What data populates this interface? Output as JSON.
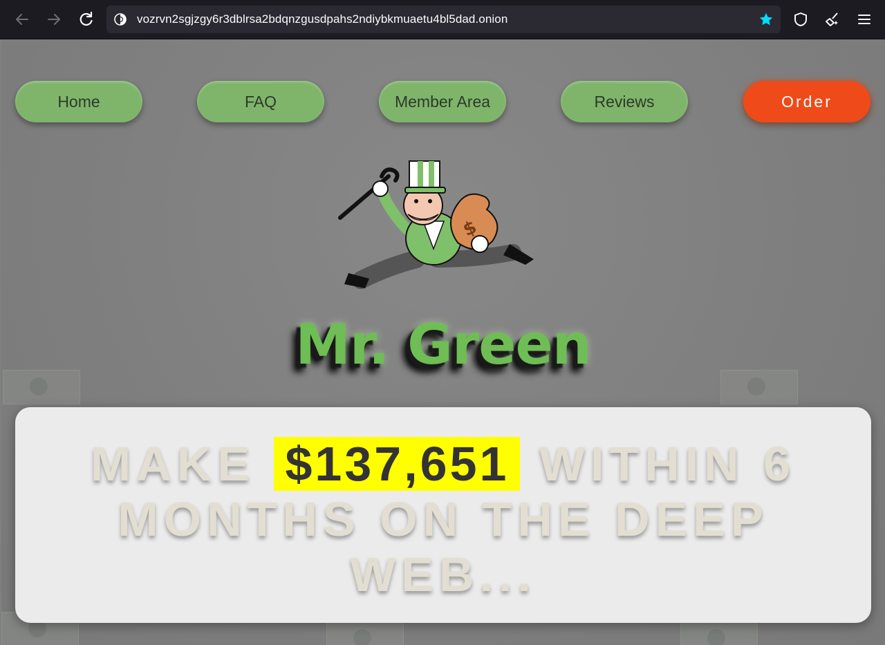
{
  "browser": {
    "url": "vozrvn2sgjzgy6r3dblrsa2bdqnzgusdpahs2ndiybkmuaetu4bl5dad.onion",
    "icons": [
      "back-arrow-icon",
      "forward-arrow-icon",
      "reload-icon",
      "tor-onion-icon",
      "bookmark-star-icon",
      "shield-icon",
      "new-identity-broom-icon",
      "menu-hamburger-icon"
    ],
    "star_color": "#00ddff"
  },
  "nav": {
    "home": "Home",
    "faq": "FAQ",
    "member_area": "Member Area",
    "reviews": "Reviews",
    "order": "Order"
  },
  "logo_text": "Mr. Green",
  "headline": {
    "pre": "MAKE ",
    "amount": "$137,651",
    "post": " WITHIN 6 MONTHS ON THE DEEP WEB..."
  },
  "colors": {
    "nav_green": "#7fb56a",
    "order_orange": "#ef4a1a",
    "logo_green": "#6fbd55",
    "highlight_yellow": "#ffff00"
  }
}
